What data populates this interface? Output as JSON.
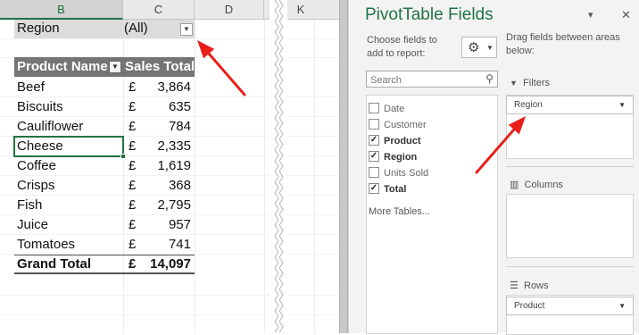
{
  "sheet": {
    "columns": [
      "B",
      "C",
      "D",
      "K"
    ],
    "filter": {
      "label": "Region",
      "value": "(All)",
      "icon": "chevron-down-icon"
    },
    "header": {
      "product": "Product Name",
      "sales": "Sales Total"
    },
    "rows": [
      {
        "product": "Beef",
        "currency": "£",
        "value": "3,864"
      },
      {
        "product": "Biscuits",
        "currency": "£",
        "value": "635"
      },
      {
        "product": "Cauliflower",
        "currency": "£",
        "value": "784"
      },
      {
        "product": "Cheese",
        "currency": "£",
        "value": "2,335"
      },
      {
        "product": "Coffee",
        "currency": "£",
        "value": "1,619"
      },
      {
        "product": "Crisps",
        "currency": "£",
        "value": "368"
      },
      {
        "product": "Fish",
        "currency": "£",
        "value": "2,795"
      },
      {
        "product": "Juice",
        "currency": "£",
        "value": "957"
      },
      {
        "product": "Tomatoes",
        "currency": "£",
        "value": "741"
      }
    ],
    "total": {
      "label": "Grand Total",
      "currency": "£",
      "value": "14,097"
    },
    "active_cell_product": "Cheese"
  },
  "pane": {
    "title": "PivotTable Fields",
    "choose_label": "Choose fields to add to report:",
    "drag_label": "Drag fields between areas below:",
    "search_placeholder": "Search",
    "gear_icon": "gear-icon",
    "fields": [
      {
        "name": "Date",
        "checked": false
      },
      {
        "name": "Customer",
        "checked": false
      },
      {
        "name": "Product",
        "checked": true
      },
      {
        "name": "Region",
        "checked": true
      },
      {
        "name": "Units Sold",
        "checked": false
      },
      {
        "name": "Total",
        "checked": true
      }
    ],
    "more_tables": "More Tables...",
    "areas": {
      "filters": {
        "label": "Filters",
        "item": "Region"
      },
      "columns": {
        "label": "Columns"
      },
      "rows": {
        "label": "Rows",
        "item": "Product"
      }
    }
  },
  "colors": {
    "accent": "#217346",
    "header_fill": "#757575",
    "annotation_arrow": "#e8201a"
  }
}
